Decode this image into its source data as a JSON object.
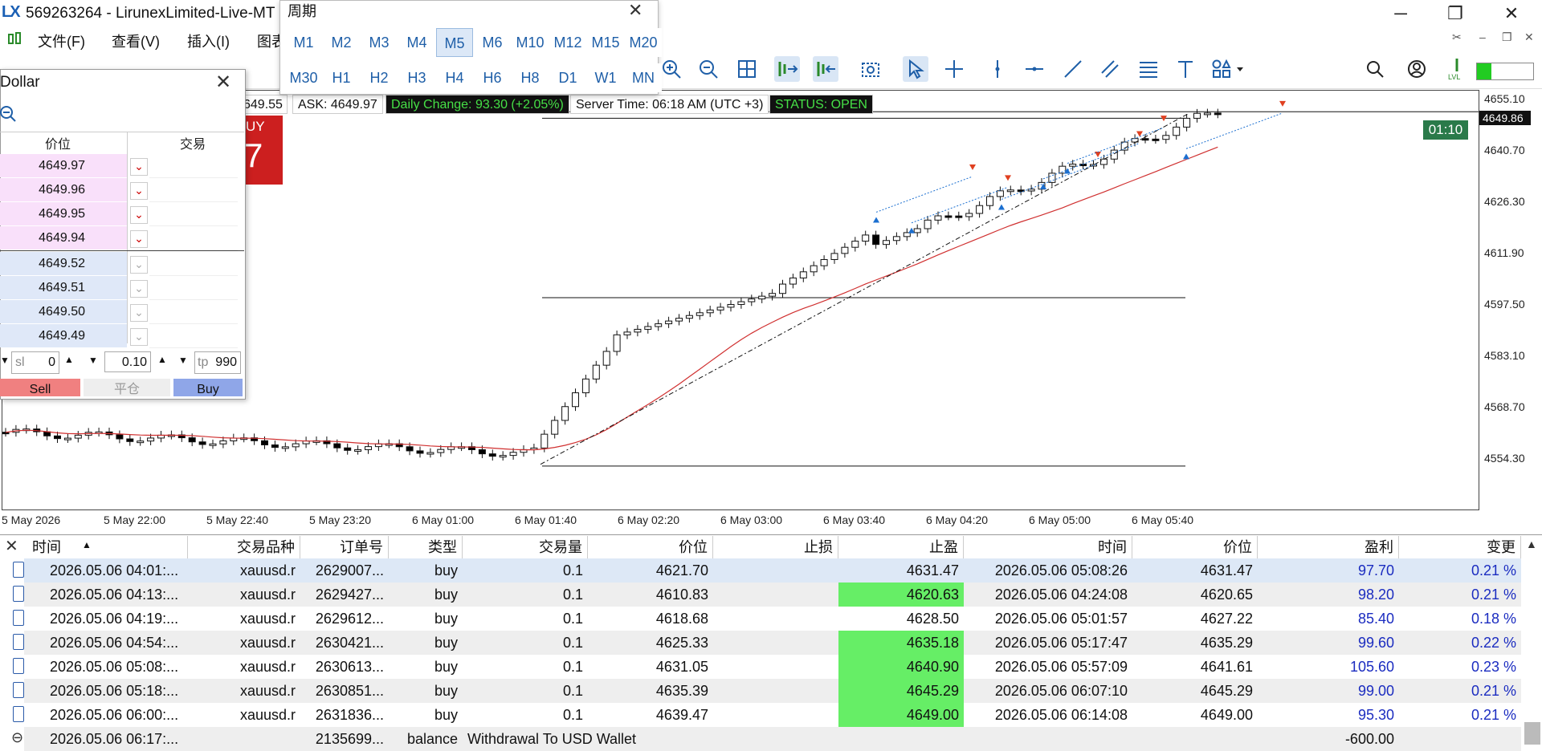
{
  "window": {
    "title": "569263264 - LirunexLimited-Live-MT",
    "minimize": "─",
    "restore": "❐",
    "close": "✕"
  },
  "menu": [
    "文件(F)",
    "查看(V)",
    "插入(I)",
    "图表"
  ],
  "period_panel": {
    "title": "周期",
    "rows": [
      [
        "M1",
        "M2",
        "M3",
        "M4",
        "M5",
        "M6",
        "M10",
        "M12",
        "M15",
        "M20"
      ],
      [
        "M30",
        "H1",
        "H2",
        "H3",
        "H4",
        "H6",
        "H8",
        "D1",
        "W1",
        "MN"
      ]
    ],
    "selected": "M5"
  },
  "info_strip": {
    "bid_partial": "649.55",
    "ask": "ASK: 4649.97",
    "daily_change": "Daily Change: 93.30 (+2.05%)",
    "server_time": "Server Time: 06:18 AM (UTC +3)",
    "status": "STATUS: OPEN"
  },
  "depth_panel": {
    "title": "Dollar",
    "col_price": "价位",
    "col_trade": "交易",
    "ask_rows": [
      "4649.97",
      "4649.96",
      "4649.95",
      "4649.94"
    ],
    "bid_rows": [
      "4649.52",
      "4649.51",
      "4649.50",
      "4649.49"
    ],
    "sl_label": "sl",
    "sl_value": "0",
    "volume": "0.10",
    "tp_label": "tp",
    "tp_value": "990",
    "sell": "Sell",
    "close": "平仓",
    "buy": "Buy",
    "buy_badge": "UY",
    "buy_digit": "7"
  },
  "chart": {
    "timer": "01:10",
    "last_price": "4649.86",
    "price_ticks": [
      "4655.10",
      "4640.70",
      "4626.30",
      "4611.90",
      "4597.50",
      "4583.10",
      "4568.70",
      "4554.30"
    ],
    "time_ticks": [
      "5 May 2026",
      "5 May 22:00",
      "5 May 22:40",
      "5 May 23:20",
      "6 May 01:00",
      "6 May 01:40",
      "6 May 02:20",
      "6 May 03:00",
      "6 May 03:40",
      "6 May 04:20",
      "6 May 05:00",
      "6 May 05:40"
    ],
    "colors": {
      "ma": "#d03030",
      "up": "#ffffff",
      "down": "#000000",
      "buy_arrow": "#1b6fd0",
      "sell_arrow": "#e04020"
    }
  },
  "table": {
    "headers": [
      "时间",
      "交易品种",
      "订单号",
      "类型",
      "交易量",
      "价位",
      "止损",
      "止盈",
      "时间",
      "价位",
      "盈利",
      "变更"
    ],
    "rows": [
      {
        "open": "2026.05.06 04:01:...",
        "sym": "xauusd.r",
        "ticket": "2629007...",
        "type": "buy",
        "vol": "0.1",
        "price": "4621.70",
        "sl": "",
        "tp": "4631.47",
        "tp_hit": false,
        "close_time": "2026.05.06 05:08:26",
        "close_price": "4631.47",
        "profit": "97.70",
        "change": "0.21 %"
      },
      {
        "open": "2026.05.06 04:13:...",
        "sym": "xauusd.r",
        "ticket": "2629427...",
        "type": "buy",
        "vol": "0.1",
        "price": "4610.83",
        "sl": "",
        "tp": "4620.63",
        "tp_hit": true,
        "close_time": "2026.05.06 04:24:08",
        "close_price": "4620.65",
        "profit": "98.20",
        "change": "0.21 %"
      },
      {
        "open": "2026.05.06 04:19:...",
        "sym": "xauusd.r",
        "ticket": "2629612...",
        "type": "buy",
        "vol": "0.1",
        "price": "4618.68",
        "sl": "",
        "tp": "4628.50",
        "tp_hit": false,
        "close_time": "2026.05.06 05:01:57",
        "close_price": "4627.22",
        "profit": "85.40",
        "change": "0.18 %"
      },
      {
        "open": "2026.05.06 04:54:...",
        "sym": "xauusd.r",
        "ticket": "2630421...",
        "type": "buy",
        "vol": "0.1",
        "price": "4625.33",
        "sl": "",
        "tp": "4635.18",
        "tp_hit": true,
        "close_time": "2026.05.06 05:17:47",
        "close_price": "4635.29",
        "profit": "99.60",
        "change": "0.22 %"
      },
      {
        "open": "2026.05.06 05:08:...",
        "sym": "xauusd.r",
        "ticket": "2630613...",
        "type": "buy",
        "vol": "0.1",
        "price": "4631.05",
        "sl": "",
        "tp": "4640.90",
        "tp_hit": true,
        "close_time": "2026.05.06 05:57:09",
        "close_price": "4641.61",
        "profit": "105.60",
        "change": "0.23 %"
      },
      {
        "open": "2026.05.06 05:18:...",
        "sym": "xauusd.r",
        "ticket": "2630851...",
        "type": "buy",
        "vol": "0.1",
        "price": "4635.39",
        "sl": "",
        "tp": "4645.29",
        "tp_hit": true,
        "close_time": "2026.05.06 06:07:10",
        "close_price": "4645.29",
        "profit": "99.00",
        "change": "0.21 %"
      },
      {
        "open": "2026.05.06 06:00:...",
        "sym": "xauusd.r",
        "ticket": "2631836...",
        "type": "buy",
        "vol": "0.1",
        "price": "4639.47",
        "sl": "",
        "tp": "4649.00",
        "tp_hit": true,
        "close_time": "2026.05.06 06:14:08",
        "close_price": "4649.00",
        "profit": "95.30",
        "change": "0.21 %"
      }
    ],
    "balance_row": {
      "open": "2026.05.06 06:17:...",
      "ticket": "2135699...",
      "type": "balance",
      "comment": "Withdrawal To USD Wallet",
      "profit": "-600.00"
    }
  }
}
